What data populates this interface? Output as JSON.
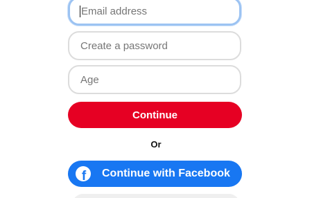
{
  "signup_form": {
    "email": {
      "value": "",
      "placeholder": "Email address"
    },
    "password": {
      "value": "",
      "placeholder": "Create a password"
    },
    "age": {
      "value": "",
      "placeholder": "Age"
    },
    "continue_label": "Continue",
    "or_label": "Or",
    "facebook_label": "Continue with Facebook",
    "facebook_icon": "facebook-f-icon"
  },
  "colors": {
    "primary_red": "#e60023",
    "facebook_blue": "#1877f2",
    "focus_border": "#9cc3f2",
    "field_border": "#dcdcdc",
    "placeholder_text": "#767676"
  }
}
